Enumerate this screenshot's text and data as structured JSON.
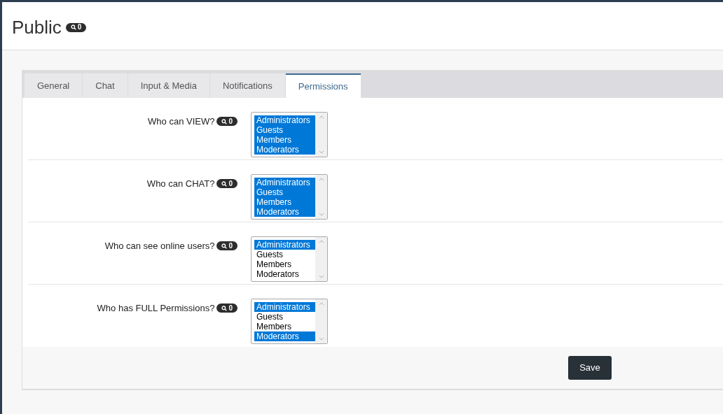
{
  "page": {
    "title": "Public",
    "badge": "0"
  },
  "tabs": [
    {
      "label": "General",
      "selected": false
    },
    {
      "label": "Chat",
      "selected": false
    },
    {
      "label": "Input & Media",
      "selected": false
    },
    {
      "label": "Notifications",
      "selected": false
    },
    {
      "label": "Permissions",
      "selected": true
    }
  ],
  "permissions": [
    {
      "label": "Who can VIEW?",
      "badge": "0",
      "options": [
        {
          "label": "Administrators",
          "selected": true
        },
        {
          "label": "Guests",
          "selected": true
        },
        {
          "label": "Members",
          "selected": true
        },
        {
          "label": "Moderators",
          "selected": true
        }
      ]
    },
    {
      "label": "Who can CHAT?",
      "badge": "0",
      "options": [
        {
          "label": "Administrators",
          "selected": true
        },
        {
          "label": "Guests",
          "selected": true
        },
        {
          "label": "Members",
          "selected": true
        },
        {
          "label": "Moderators",
          "selected": true
        }
      ]
    },
    {
      "label": "Who can see online users?",
      "badge": "0",
      "options": [
        {
          "label": "Administrators",
          "selected": true
        },
        {
          "label": "Guests",
          "selected": false
        },
        {
          "label": "Members",
          "selected": false
        },
        {
          "label": "Moderators",
          "selected": false
        }
      ]
    },
    {
      "label": "Who has FULL Permissions?",
      "badge": "0",
      "options": [
        {
          "label": "Administrators",
          "selected": true
        },
        {
          "label": "Guests",
          "selected": false
        },
        {
          "label": "Members",
          "selected": false
        },
        {
          "label": "Moderators",
          "selected": true
        }
      ]
    }
  ],
  "save_button": "Save"
}
